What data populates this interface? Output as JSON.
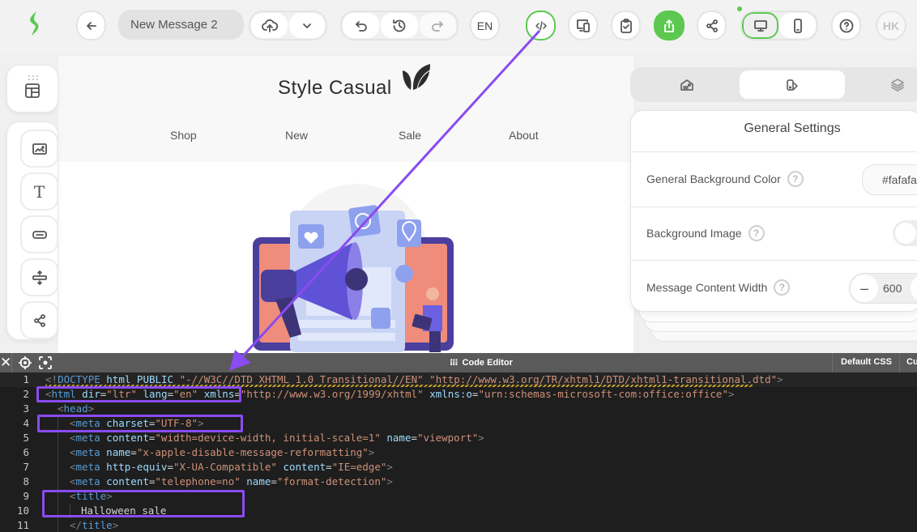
{
  "topbar": {
    "message_title": "New Message 2",
    "language": "EN",
    "avatar_initials": "HK",
    "icons": {
      "logo": "stripo-logo-icon",
      "back": "arrow-left-icon",
      "save_cloud": "cloud-upload-icon",
      "more": "chevron-down-icon",
      "undo": "undo-icon",
      "history": "history-icon",
      "redo": "redo-icon",
      "code": "code-icon",
      "preview_devices": "devices-icon",
      "test": "clipboard-check-icon",
      "export": "export-icon",
      "share": "share-icon",
      "desktop": "desktop-icon",
      "mobile": "mobile-icon",
      "help": "help-icon"
    },
    "accent_color": "#5cc84f"
  },
  "email_preview": {
    "brand": "Style Casual",
    "nav": [
      "Shop",
      "New",
      "Sale",
      "About"
    ],
    "hero_image": "megaphone-marketing-illustration"
  },
  "tool_panel": {
    "blocks_icon": "blocks-layout-icon",
    "items": [
      {
        "name": "image",
        "icon": "image-icon"
      },
      {
        "name": "text",
        "icon": "text-icon"
      },
      {
        "name": "button",
        "icon": "button-icon"
      },
      {
        "name": "spacer",
        "icon": "spacer-icon"
      },
      {
        "name": "social",
        "icon": "share-icon"
      }
    ]
  },
  "right_panel": {
    "tabs": [
      {
        "name": "message-settings",
        "icon": "envelope-icon",
        "active": false
      },
      {
        "name": "appearance",
        "icon": "palette-icon",
        "active": true
      },
      {
        "name": "layers",
        "icon": "layers-icon",
        "active": false
      }
    ],
    "section_title": "General Settings",
    "rows": [
      {
        "label": "General Background Color",
        "value": "#fafafa"
      },
      {
        "label": "Background Image",
        "toggle": false
      },
      {
        "label": "Message Content Width",
        "value": "600"
      }
    ]
  },
  "code_editor": {
    "title": "Code Editor",
    "tabs": [
      "Default CSS",
      "Cu"
    ],
    "lines": [
      {
        "n": "1",
        "text": "<!DOCTYPE html PUBLIC \"-//W3C//DTD XHTML 1.0 Transitional//EN\" \"http://www.w3.org/TR/xhtml1/DTD/xhtml1-transitional.dtd\">"
      },
      {
        "n": "2",
        "text": "<html dir=\"ltr\" lang=\"en\" xmlns=\"http://www.w3.org/1999/xhtml\" xmlns:o=\"urn:schemas-microsoft-com:office:office\">"
      },
      {
        "n": "3",
        "text": "<head>"
      },
      {
        "n": "4",
        "text": "<meta charset=\"UTF-8\">"
      },
      {
        "n": "5",
        "text": "<meta content=\"width=device-width, initial-scale=1\" name=\"viewport\">"
      },
      {
        "n": "6",
        "text": "<meta name=\"x-apple-disable-message-reformatting\">"
      },
      {
        "n": "7",
        "text": "<meta http-equiv=\"X-UA-Compatible\" content=\"IE=edge\">"
      },
      {
        "n": "8",
        "text": "<meta content=\"telephone=no\" name=\"format-detection\">"
      },
      {
        "n": "9",
        "text": "<title>"
      },
      {
        "n": "10",
        "text": "Halloween sale"
      },
      {
        "n": "11",
        "text": "</title>"
      }
    ]
  },
  "annotation": {
    "arrow_color": "#8a4bf0",
    "highlight_color": "#8a4bf0"
  }
}
